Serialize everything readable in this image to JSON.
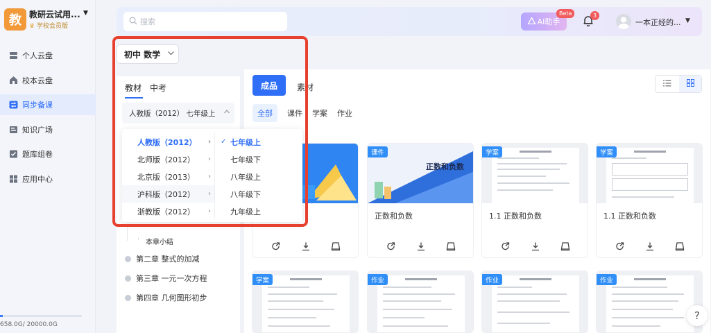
{
  "org": {
    "logo_text": "教",
    "name": "教研云试用...",
    "member": "学校会员版"
  },
  "sidebar": {
    "items": [
      {
        "label": "个人云盘",
        "icon": "cloud-drive-icon"
      },
      {
        "label": "校本云盘",
        "icon": "school-icon"
      },
      {
        "label": "同步备课",
        "icon": "sync-icon",
        "active": true
      },
      {
        "label": "知识广场",
        "icon": "book-icon"
      },
      {
        "label": "题库组卷",
        "icon": "checklist-icon"
      },
      {
        "label": "应用中心",
        "icon": "apps-icon"
      }
    ],
    "storage_text": "658.0G/ 20000.0G",
    "storage_fraction": 0.033
  },
  "header": {
    "search_placeholder": "搜索",
    "ai_label": "AI助手",
    "beta_label": "Beta",
    "notification_count": "3",
    "user_name": "一本正经的..."
  },
  "grade_select": {
    "value": "初中 数学"
  },
  "left_panel": {
    "tabs": [
      "教材",
      "中考"
    ],
    "edition": "人教版（2012） 七年级上",
    "chapter_sub": "本章小结",
    "chapters": [
      "第二章 整式的加减",
      "第三章 一元一次方程",
      "第四章 几何图形初步"
    ]
  },
  "dropdown": {
    "editions": [
      "人教版（2012）",
      "北师版（2012）",
      "北京版（2013）",
      "沪科版（2012）",
      "浙教版（2012）"
    ],
    "grades": [
      "七年级上",
      "七年级下",
      "八年级上",
      "八年级下",
      "九年级上"
    ]
  },
  "right_panel": {
    "tabs": [
      "成品",
      "素材"
    ],
    "filters": [
      "全部",
      "课件",
      "学案",
      "作业"
    ],
    "cards_row1": [
      {
        "tag": "",
        "title": ""
      },
      {
        "tag": "课件",
        "title": "正数和负数",
        "thumb_text": "正数和负数"
      },
      {
        "tag": "学案",
        "title": "1.1 正数和负数"
      },
      {
        "tag": "学案",
        "title": "1.1 正数和负数"
      }
    ],
    "cards_row2": [
      {
        "tag": "学案"
      },
      {
        "tag": "作业"
      },
      {
        "tag": "作业"
      },
      {
        "tag": "作业"
      }
    ]
  },
  "help": {
    "label": "?"
  },
  "colors": {
    "accent": "#2f6ef7",
    "highlight_border": "#e8402f",
    "logo": "#f29a3a"
  }
}
